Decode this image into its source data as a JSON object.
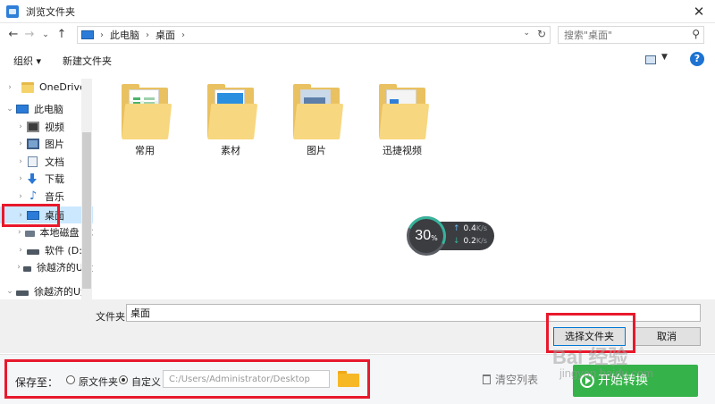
{
  "window": {
    "title": "浏览文件夹",
    "close": "✕"
  },
  "address": {
    "crumbs": [
      "此电脑",
      "桌面"
    ],
    "separator": "›"
  },
  "search": {
    "placeholder": "搜索\"桌面\""
  },
  "toolbar": {
    "organize_label": "组织 ▾",
    "new_folder_label": "新建文件夹",
    "help": "?"
  },
  "sidebar": {
    "items": [
      {
        "label": "OneDrive",
        "icon": "folder-icon"
      },
      {
        "label": "此电脑",
        "icon": "computer-icon"
      },
      {
        "label": "视频",
        "icon": "video-icon"
      },
      {
        "label": "图片",
        "icon": "pictures-icon"
      },
      {
        "label": "文档",
        "icon": "documents-icon"
      },
      {
        "label": "下载",
        "icon": "download-icon"
      },
      {
        "label": "音乐",
        "icon": "music-icon"
      },
      {
        "label": "桌面",
        "icon": "desktop-icon",
        "selected": true
      },
      {
        "label": "本地磁盘 (C",
        "icon": "drive-icon"
      },
      {
        "label": "软件 (D:)",
        "icon": "drive-icon"
      },
      {
        "label": "徐越济的U盘",
        "icon": "usb-drive-icon"
      },
      {
        "label": "徐越济的U盘",
        "icon": "usb-drive-icon"
      }
    ]
  },
  "files": [
    {
      "name": "常用",
      "icon": "folder-icon"
    },
    {
      "name": "素材",
      "icon": "folder-icon"
    },
    {
      "name": "图片",
      "icon": "folder-icon"
    },
    {
      "name": "迅捷视频",
      "icon": "folder-icon"
    }
  ],
  "speed_widget": {
    "percent": "30",
    "percent_sign": "%",
    "up": "0.4",
    "down": "0.2",
    "unit": "K/s"
  },
  "dialog_footer": {
    "folder_label": "文件夹:",
    "folder_value": "桌面",
    "select_button": "选择文件夹",
    "cancel_button": "取消"
  },
  "app_bar": {
    "save_to_label": "保存至：",
    "option_original": "原文件夹",
    "option_custom": "自定义",
    "selected_option": "自定义",
    "path": "C:/Users/Administrator/Desktop",
    "clear_list": "清空列表",
    "start_button": "开始转换"
  },
  "watermark": {
    "brand": "Bai 经验",
    "url": "jingyan.baidu.com"
  },
  "colors": {
    "accent": "#35b34a",
    "highlight": "#e8192c",
    "selection": "#cce8ff"
  }
}
